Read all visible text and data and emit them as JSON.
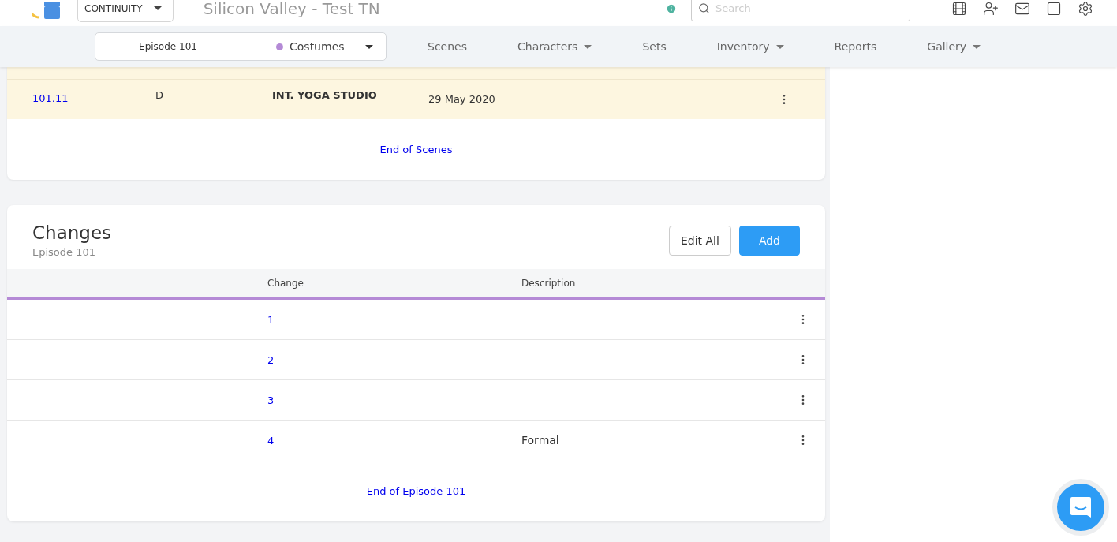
{
  "header": {
    "app_menu": "CONTINUITY",
    "title": "Silicon Valley - Test TN",
    "search": {
      "placeholder": "Search"
    }
  },
  "nav": {
    "episode": "Episode 101",
    "department": {
      "label": "Costumes",
      "color": "#b48ad6"
    },
    "items": [
      {
        "label": "Scenes",
        "dropdown": false
      },
      {
        "label": "Characters",
        "dropdown": true
      },
      {
        "label": "Sets",
        "dropdown": false
      },
      {
        "label": "Inventory",
        "dropdown": true
      },
      {
        "label": "Reports",
        "dropdown": false
      },
      {
        "label": "Gallery",
        "dropdown": true
      }
    ]
  },
  "scenes": {
    "rows": [
      {
        "scene": "101.11",
        "time": "D",
        "set": "INT. YOGA STUDIO",
        "date": "29 May 2020"
      }
    ],
    "footer": "End of Scenes"
  },
  "changes": {
    "title": "Changes",
    "subtitle": "Episode 101",
    "buttons": [
      "Edit All",
      "Add"
    ],
    "columns": [
      "Change",
      "Description"
    ],
    "rows": [
      {
        "change": "1",
        "description": ""
      },
      {
        "change": "2",
        "description": ""
      },
      {
        "change": "3",
        "description": ""
      },
      {
        "change": "4",
        "description": "Formal"
      }
    ],
    "footer": "End of Episode 101"
  }
}
